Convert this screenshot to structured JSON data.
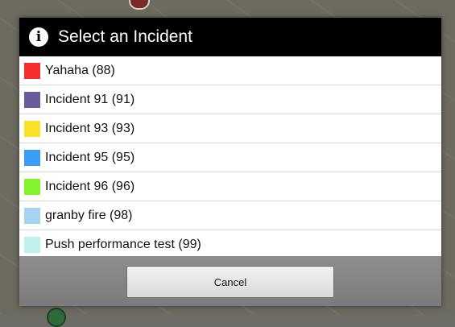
{
  "dialog": {
    "title": "Select an Incident",
    "icon": "info-icon",
    "items": [
      {
        "label": "Yahaha (88)",
        "color": "#f52f2f"
      },
      {
        "label": "Incident 91 (91)",
        "color": "#6a5a9c"
      },
      {
        "label": "Incident 93 (93)",
        "color": "#fde02a"
      },
      {
        "label": "Incident 95 (95)",
        "color": "#3a9cf2"
      },
      {
        "label": "Incident 96 (96)",
        "color": "#84f430"
      },
      {
        "label": "granby fire (98)",
        "color": "#a5d3f2"
      },
      {
        "label": "Push performance test  (99)",
        "color": "#bff0ef"
      }
    ],
    "cancel_label": "Cancel"
  }
}
